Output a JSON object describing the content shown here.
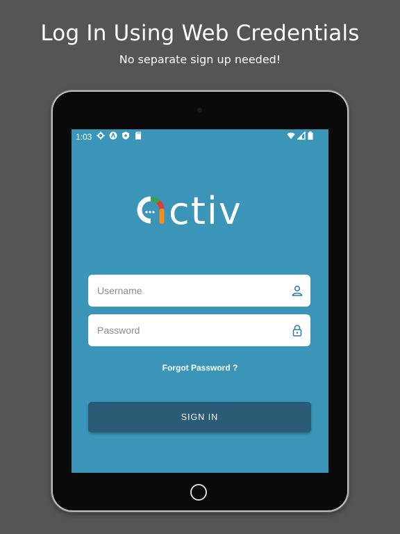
{
  "promo": {
    "headline": "Log In Using Web Credentials",
    "subline": "No separate sign up needed!"
  },
  "status_bar": {
    "time": "1:03",
    "left_icons": [
      "gear-icon",
      "a-badge-icon",
      "shield-icon",
      "sd-card-icon"
    ],
    "right_icons": [
      "wifi-icon",
      "signal-icon",
      "battery-icon"
    ]
  },
  "app": {
    "logo_text": "activ",
    "background_color": "#3a95b8",
    "username": {
      "placeholder": "Username",
      "icon": "user-icon"
    },
    "password": {
      "placeholder": "Password",
      "icon": "lock-icon"
    },
    "forgot_password": "Forgot Password ?",
    "sign_in": "SIGN IN",
    "button_color": "#2b5b75",
    "accent_colors": [
      "#3aa346",
      "#e03c31",
      "#f28c1b"
    ]
  }
}
